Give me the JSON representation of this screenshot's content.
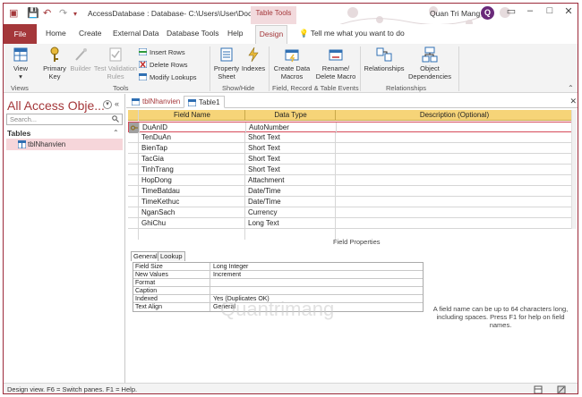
{
  "window": {
    "title": "AccessDatabase : Database- C:\\Users\\User\\Docu...",
    "context_tab": "Table Tools",
    "user": "Quan Tri Mang",
    "user_initial": "Q"
  },
  "ribbon_tabs": [
    "File",
    "Home",
    "Create",
    "External Data",
    "Database Tools",
    "Help",
    "Design"
  ],
  "tell_me": "Tell me what you want to do",
  "ribbon": {
    "view_label": "View",
    "primary_key_label": "Primary Key",
    "builder_label": "Builder",
    "test_validation_label": "Test Validation Rules",
    "insert_rows": "Insert Rows",
    "delete_rows": "Delete Rows",
    "modify_lookups": "Modify Lookups",
    "property_sheet": "Property Sheet",
    "indexes": "Indexes",
    "create_data_macros": "Create Data Macros",
    "rename_delete_macro": "Rename/ Delete Macro",
    "relationships": "Relationships",
    "object_dependencies": "Object Dependencies",
    "groups": [
      "Views",
      "Tools",
      "Show/Hide",
      "Field, Record & Table Events",
      "Relationships"
    ]
  },
  "nav": {
    "title": "All Access Obje...",
    "search_placeholder": "Search...",
    "group": "Tables",
    "items": [
      "tblNhanvien"
    ]
  },
  "doc_tabs": [
    "tblNhanvien",
    "Table1"
  ],
  "grid": {
    "headers": [
      "Field Name",
      "Data Type",
      "Description (Optional)"
    ],
    "rows": [
      {
        "name": "DuAnID",
        "type": "AutoNumber"
      },
      {
        "name": "TenDuAn",
        "type": "Short Text"
      },
      {
        "name": "BienTap",
        "type": "Short Text"
      },
      {
        "name": "TacGia",
        "type": "Short Text"
      },
      {
        "name": "TinhTrang",
        "type": "Short Text"
      },
      {
        "name": "HopDong",
        "type": "Attachment"
      },
      {
        "name": "TimeBatdau",
        "type": "Date/Time"
      },
      {
        "name": "TimeKethuc",
        "type": "Date/Time"
      },
      {
        "name": "NganSach",
        "type": "Currency"
      },
      {
        "name": "GhiChu",
        "type": "Long Text"
      }
    ]
  },
  "field_properties": {
    "header": "Field Properties",
    "tabs": [
      "General",
      "Lookup"
    ],
    "rows": [
      {
        "name": "Field Size",
        "value": "Long Integer"
      },
      {
        "name": "New Values",
        "value": "Increment"
      },
      {
        "name": "Format",
        "value": ""
      },
      {
        "name": "Caption",
        "value": ""
      },
      {
        "name": "Indexed",
        "value": "Yes (Duplicates OK)"
      },
      {
        "name": "Text Align",
        "value": "General"
      }
    ],
    "help": "A field name can be up to 64 characters long, including spaces. Press F1 for help on field names."
  },
  "watermark": "Quantrimang",
  "status": "Design view.  F6 = Switch panes.  F1 = Help.",
  "colors": {
    "accent": "#a4373a",
    "header_fill": "#f6d478",
    "selection": "#f6d6da"
  }
}
